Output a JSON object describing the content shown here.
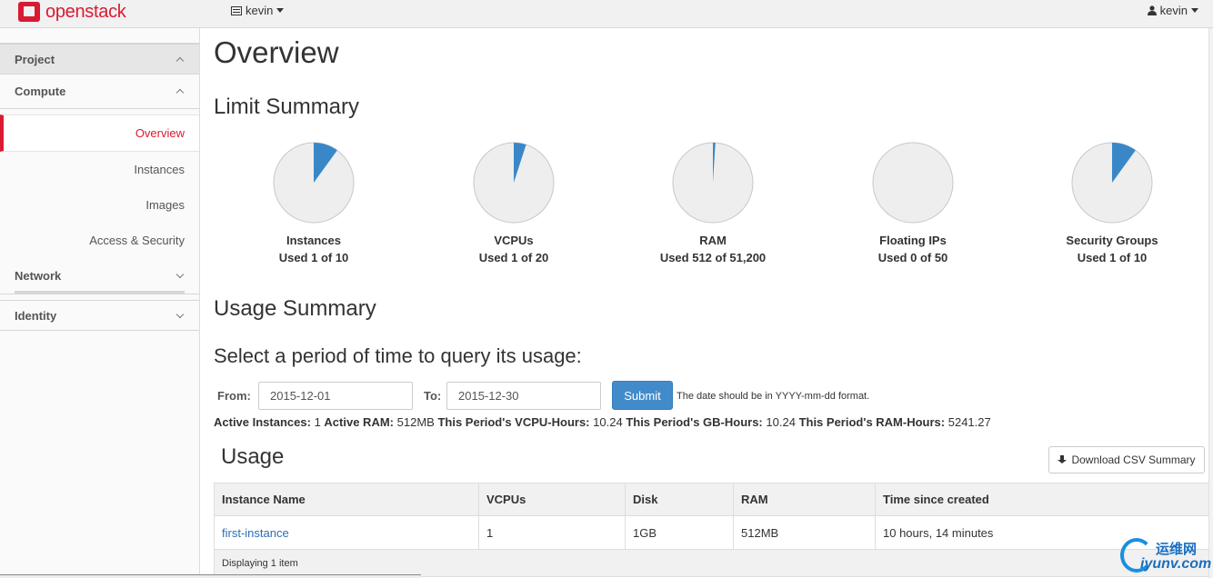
{
  "header": {
    "brand": "openstack",
    "project_selector": "kevin",
    "user_menu": "kevin"
  },
  "sidebar": {
    "project": "Project",
    "compute": "Compute",
    "items": [
      "Overview",
      "Instances",
      "Images",
      "Access & Security"
    ],
    "network": "Network",
    "identity": "Identity"
  },
  "main": {
    "title": "Overview",
    "limit_summary": "Limit Summary",
    "limits": [
      {
        "title": "Instances",
        "used_text": "Used 1 of 10",
        "used": 1,
        "total": 10
      },
      {
        "title": "VCPUs",
        "used_text": "Used 1 of 20",
        "used": 1,
        "total": 20
      },
      {
        "title": "RAM",
        "used_text": "Used 512 of 51,200",
        "used": 512,
        "total": 51200
      },
      {
        "title": "Floating IPs",
        "used_text": "Used 0 of 50",
        "used": 0,
        "total": 50
      },
      {
        "title": "Security Groups",
        "used_text": "Used 1 of 10",
        "used": 1,
        "total": 10
      }
    ],
    "usage_summary": "Usage Summary",
    "select_period": "Select a period of time to query its usage:",
    "form": {
      "from_label": "From:",
      "from_value": "2015-12-01",
      "to_label": "To:",
      "to_value": "2015-12-30",
      "submit": "Submit",
      "hint": "The date should be in YYYY-mm-dd format."
    },
    "stats": {
      "active_instances_label": "Active Instances:",
      "active_instances": "1",
      "active_ram_label": "Active RAM:",
      "active_ram": "512MB",
      "vcpu_hours_label": "This Period's VCPU-Hours:",
      "vcpu_hours": "10.24",
      "gb_hours_label": "This Period's GB-Hours:",
      "gb_hours": "10.24",
      "ram_hours_label": "This Period's RAM-Hours:",
      "ram_hours": "5241.27"
    },
    "usage_title": "Usage",
    "download_csv": "Download CSV Summary",
    "table": {
      "columns": [
        "Instance Name",
        "VCPUs",
        "Disk",
        "RAM",
        "Time since created"
      ],
      "rows": [
        [
          "first-instance",
          "1",
          "1GB",
          "512MB",
          "10 hours, 14 minutes"
        ]
      ],
      "footer": "Displaying 1 item"
    }
  },
  "watermark": {
    "cn": "运维网",
    "en": "iyunv.com"
  },
  "colors": {
    "brand_red": "#da1a32",
    "pie_fill": "#3a87c8",
    "pie_bg": "#eeeeee",
    "button_blue": "#428bca",
    "link_blue": "#2a6fb5"
  }
}
